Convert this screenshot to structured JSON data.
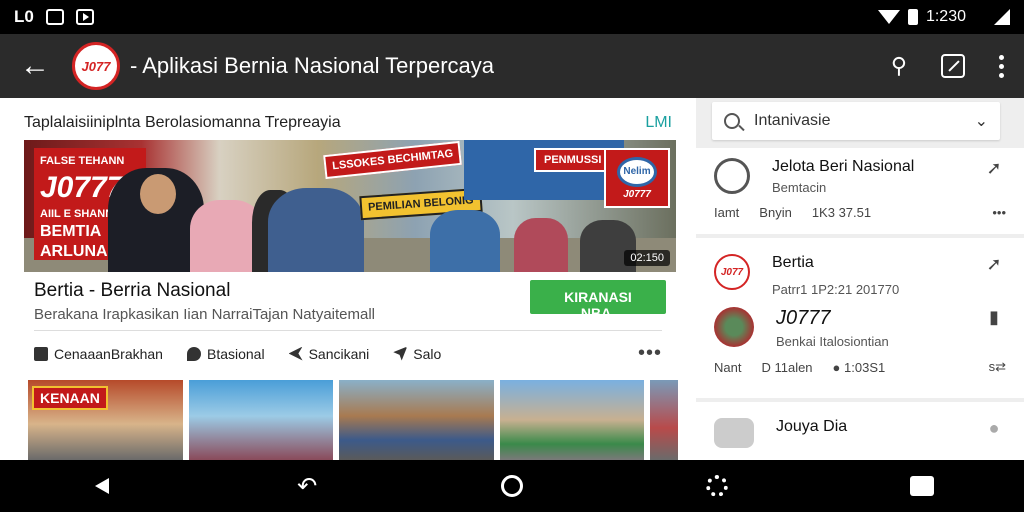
{
  "status_bar": {
    "left_text": "L0",
    "time": "1:230"
  },
  "app_bar": {
    "logo_text": "J077",
    "title": "- Aplikasi Bernia Nasional Terpercaya"
  },
  "main": {
    "header_text": "Taplalaisiiniplnta Berolasiomanna Trepreayia",
    "header_tag": "LMI",
    "hero": {
      "sign_lines": [
        "FALSE TEHANN",
        "J0777",
        "AIIL E SHANN",
        "BEMTIA",
        "ARLUNA"
      ],
      "badge_1": "LSSOKES BECHIMTAG",
      "badge_2": "PEMILIAN BELONIG",
      "sign_red": "PENMUSSI",
      "flag_logo": "Nelim",
      "flag_text": "J0777",
      "count": "02:150"
    },
    "card": {
      "title": "Bertia - Berria Nasional",
      "subtitle": "Berakana Irapkasikan Iian NarraiTajan Natyaitemall",
      "follow_label": "KIRANASI NBA."
    },
    "actions": [
      {
        "label": "CenaaanBrakhan",
        "icon": "home-icon"
      },
      {
        "label": "Btasional",
        "icon": "pin-icon"
      },
      {
        "label": "Sancikani",
        "icon": "share-icon"
      },
      {
        "label": "Salo",
        "icon": "send-icon"
      }
    ],
    "thumbnails": [
      {
        "label": "KENAAN"
      },
      {
        "label": ""
      },
      {
        "label": ""
      },
      {
        "label": ""
      },
      {
        "label": ""
      }
    ]
  },
  "side": {
    "search": {
      "value": "Intanivasie"
    },
    "items": [
      {
        "title": "Jelota Beri Nasional",
        "subtitle": "Bemtacin",
        "meta_left": "Iamt",
        "meta_mid": "Bnyin",
        "meta_time": "1K3 37.51",
        "meta_right": "•••"
      },
      {
        "title": "Bertia",
        "subtitle": "Patrr1 1P2:21  201770",
        "avatar_text": "J077"
      },
      {
        "title": "J0777",
        "subtitle": "Benkai Italosiontian",
        "meta_left": "Nant",
        "meta_mid": "D 11alen",
        "meta_time": "● 1:03S1",
        "meta_right": "s⇄"
      },
      {
        "title": "Jouya Dia"
      }
    ]
  },
  "colors": {
    "accent_red": "#c21a1a",
    "follow_green": "#3ab04a",
    "app_bar": "#2b2b2b",
    "tag_teal": "#1aa0a0"
  }
}
